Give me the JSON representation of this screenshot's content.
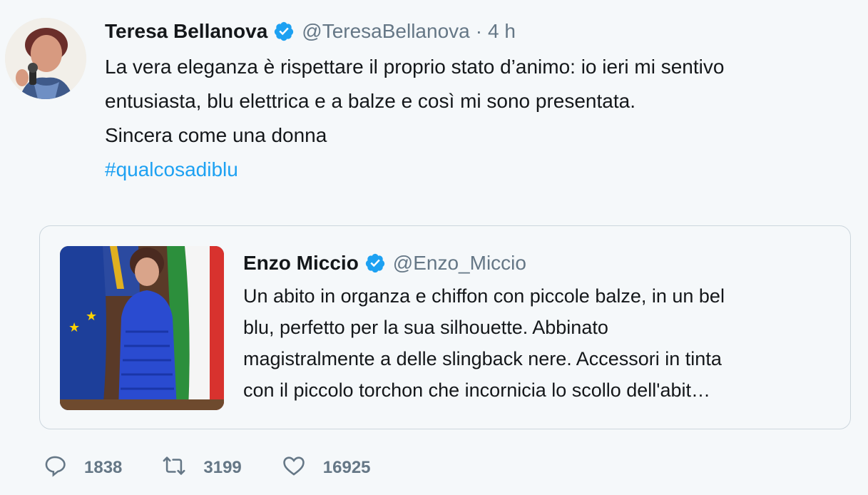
{
  "tweet": {
    "name": "Teresa Bellanova",
    "handle": "@TeresaBellanova",
    "separator": "·",
    "time": "4 h",
    "lines": [
      "La vera eleganza è rispettare il proprio stato d’animo: io ieri mi sentivo",
      "entusiasta, blu elettrica e a balze e così mi sono presentata.",
      "Sincera come una donna"
    ],
    "hashtag": "#qualcosadiblu"
  },
  "quoted": {
    "name": "Enzo Miccio",
    "handle": "@Enzo_Miccio",
    "lines": [
      "Un abito in organza e chiffon con piccole balze, in un bel",
      "blu, perfetto per la sua silhouette. Abbinato",
      "magistralmente a delle slingback nere. Accessori in tinta",
      "con il piccolo torchon che incornicia lo scollo dell'abit…"
    ]
  },
  "actions": {
    "replies": "1838",
    "retweets": "3199",
    "likes": "16925"
  },
  "icons": [
    "verified-badge-icon",
    "reply-icon",
    "retweet-icon",
    "like-icon"
  ],
  "colors": {
    "link": "#1da1f2",
    "verified": "#1da1f2",
    "muted": "#657786",
    "background": "#f5f8fa"
  }
}
